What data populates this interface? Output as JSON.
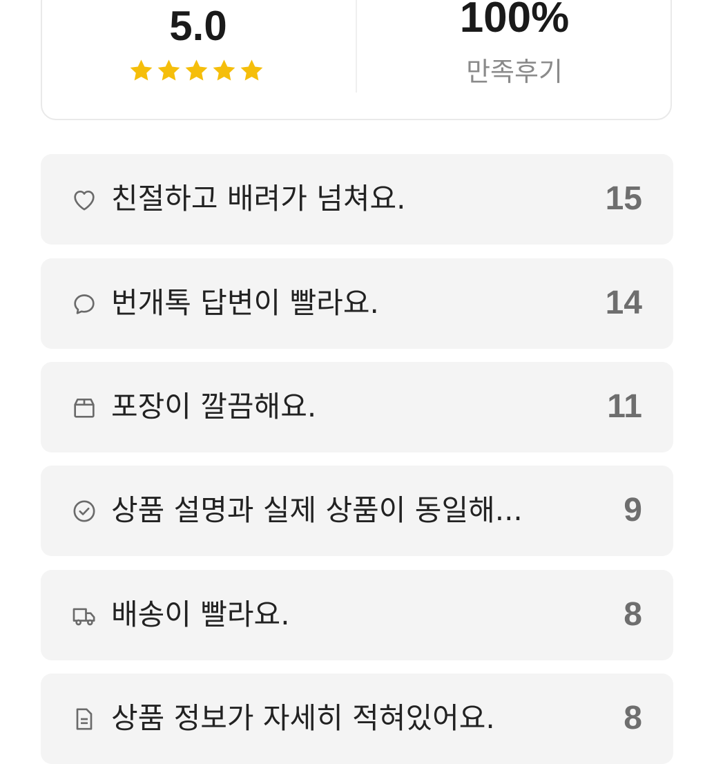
{
  "summary": {
    "rating": "5.0",
    "stars": 5,
    "star_color": "#f5be0b",
    "satisfaction": "100%",
    "satisfaction_label": "만족후기"
  },
  "reviews": [
    {
      "icon": "heart-icon",
      "label": "친절하고 배려가 넘쳐요.",
      "count": "15"
    },
    {
      "icon": "chat-bubble-icon",
      "label": "번개톡 답변이 빨라요.",
      "count": "14"
    },
    {
      "icon": "box-icon",
      "label": "포장이 깔끔해요.",
      "count": "11"
    },
    {
      "icon": "check-circle-icon",
      "label": "상품 설명과 실제 상품이 동일해...",
      "count": "9"
    },
    {
      "icon": "truck-icon",
      "label": "배송이 빨라요.",
      "count": "8"
    },
    {
      "icon": "document-icon",
      "label": "상품 정보가 자세히 적혀있어요.",
      "count": "8"
    }
  ]
}
